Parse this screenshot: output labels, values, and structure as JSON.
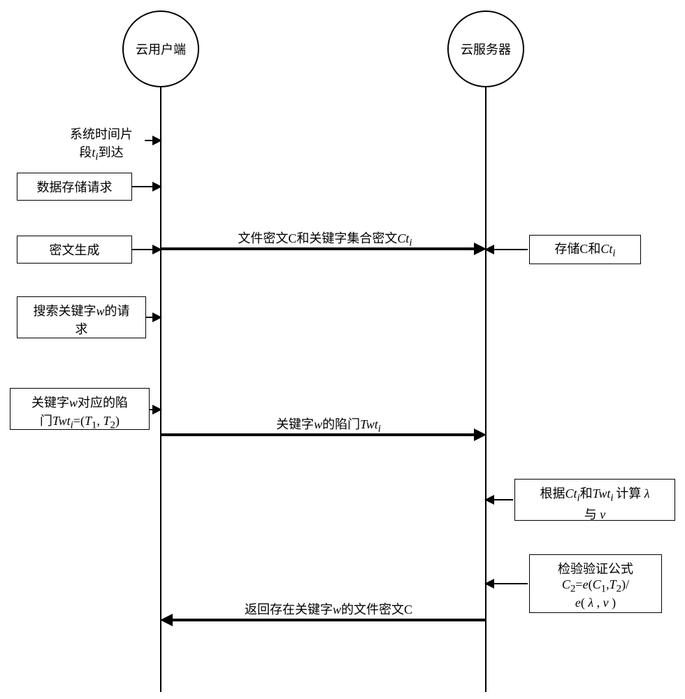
{
  "actors": {
    "client": "云用户端",
    "server": "云服务器"
  },
  "client_boxes": {
    "timeslice_l1": "系统时间片",
    "timeslice_l2_a": "段",
    "timeslice_l2_b": "t",
    "timeslice_l2_c": "i",
    "timeslice_l2_d": "到达",
    "store_req": "数据存储请求",
    "cipher_gen": "密文生成",
    "search_req_l1_a": "搜索关键字",
    "search_req_l1_b": "w",
    "search_req_l1_c": "的请",
    "search_req_l2": "求",
    "trapdoor_l1_a": "关键字",
    "trapdoor_l1_b": "w",
    "trapdoor_l1_c": "对应的陷",
    "trapdoor_l2_a": "门",
    "trapdoor_l2_b": "Twt",
    "trapdoor_l2_c": "i",
    "trapdoor_l2_d": "=(",
    "trapdoor_l2_e": "T",
    "trapdoor_l2_f": "1",
    "trapdoor_l2_g": ", ",
    "trapdoor_l2_h": "T",
    "trapdoor_l2_i": "2",
    "trapdoor_l2_j": ")"
  },
  "server_boxes": {
    "store_l1": "存储C和",
    "store_l2": "Ct",
    "store_l3": "i",
    "calc_l1_a": "根据",
    "calc_l1_b": "Ct",
    "calc_l1_c": "i",
    "calc_l1_d": "和",
    "calc_l1_e": "Twt",
    "calc_l1_f": "i ",
    "calc_l1_g": "计算",
    "calc_l1_h": "λ",
    "calc_l2_a": "与",
    "calc_l2_b": "ν",
    "verify_l1": "检验验证公式",
    "verify_l2_a": "C",
    "verify_l2_b": "2",
    "verify_l2_c": "=",
    "verify_l2_d": "e",
    "verify_l2_e": "(",
    "verify_l2_f": "C",
    "verify_l2_g": "1",
    "verify_l2_h": ",",
    "verify_l2_i": "T",
    "verify_l2_j": "2",
    "verify_l2_k": ")/",
    "verify_l3_a": "e",
    "verify_l3_b": "( ",
    "verify_l3_c": "λ",
    "verify_l3_d": " , ",
    "verify_l3_e": "ν",
    "verify_l3_f": " )"
  },
  "messages": {
    "m1_a": "文件密文C和关键字集合密文",
    "m1_b": "Ct",
    "m1_c": "i",
    "m2_a": "关键字",
    "m2_b": "w",
    "m2_c": "的陷门",
    "m2_d": "Twt",
    "m2_e": "i",
    "m3_a": "返回存在关键字",
    "m3_b": "w",
    "m3_c": "的文件密文C"
  }
}
